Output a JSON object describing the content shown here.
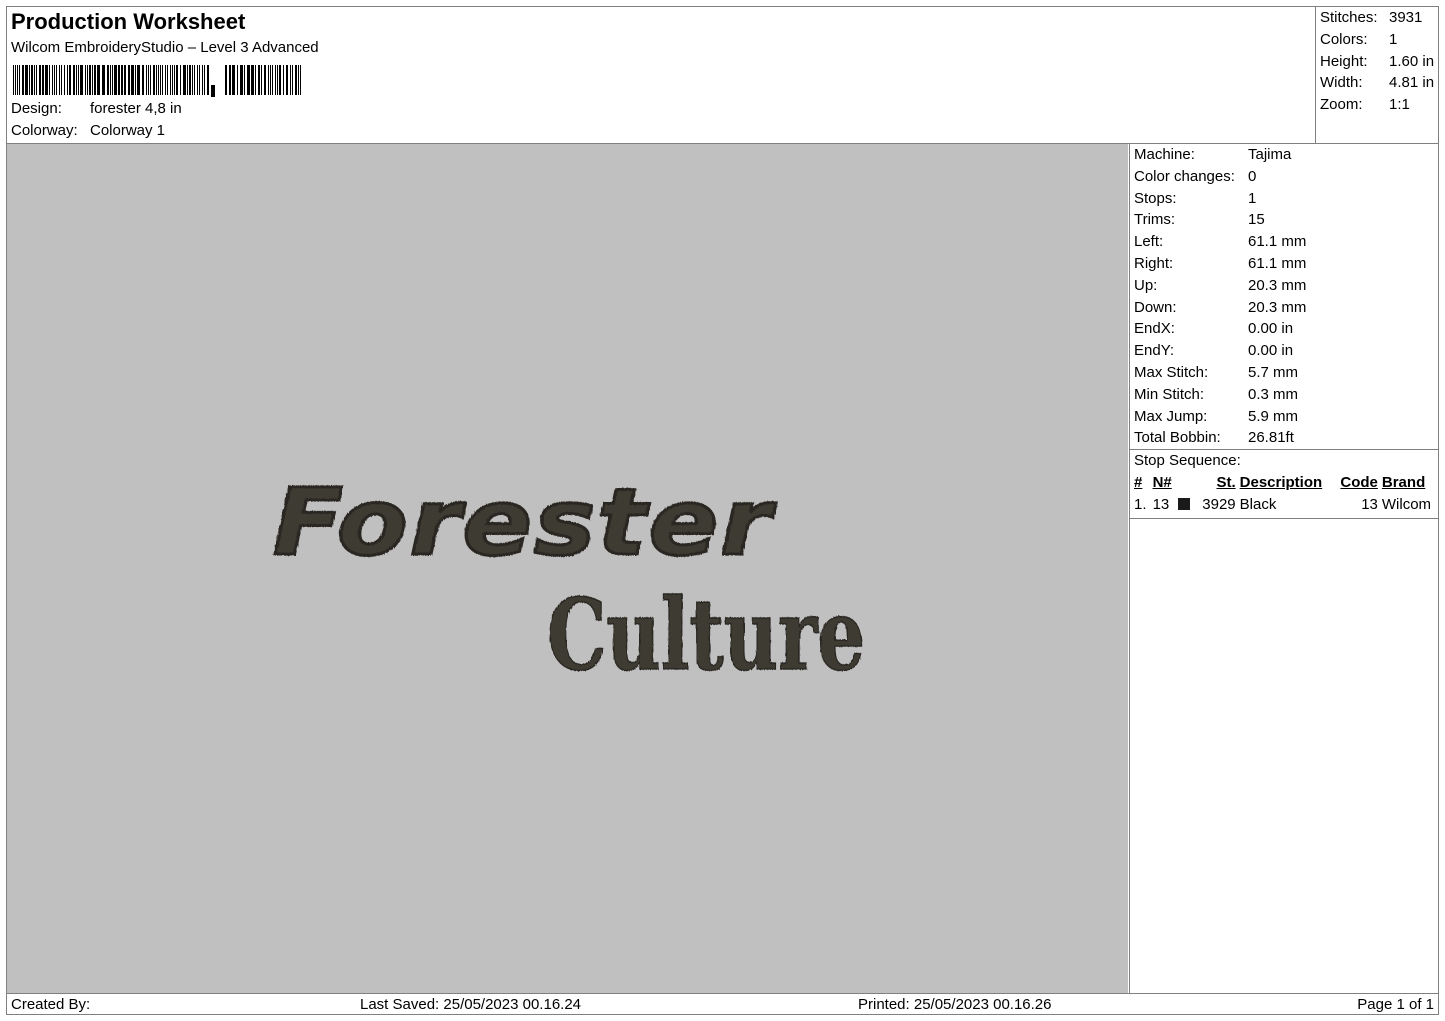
{
  "header": {
    "title": "Production Worksheet",
    "software": "Wilcom EmbroideryStudio – Level 3 Advanced",
    "design_label": "Design:",
    "design_value": "forester 4,8 in",
    "colorway_label": "Colorway:",
    "colorway_value": "Colorway 1"
  },
  "stats": [
    {
      "label": "Stitches:",
      "value": "3931"
    },
    {
      "label": "Colors:",
      "value": "1"
    },
    {
      "label": "Height:",
      "value": "1.60 in"
    },
    {
      "label": "Width:",
      "value": "4.81 in"
    },
    {
      "label": "Zoom:",
      "value": "1:1"
    }
  ],
  "machine_info": [
    {
      "label": "Machine:",
      "value": "Tajima"
    },
    {
      "label": "Color changes:",
      "value": "0"
    },
    {
      "label": "Stops:",
      "value": "1"
    },
    {
      "label": "Trims:",
      "value": "15"
    },
    {
      "label": "Left:",
      "value": "61.1 mm"
    },
    {
      "label": "Right:",
      "value": "61.1 mm"
    },
    {
      "label": "Up:",
      "value": "20.3 mm"
    },
    {
      "label": "Down:",
      "value": "20.3 mm"
    },
    {
      "label": "EndX:",
      "value": "0.00 in"
    },
    {
      "label": "EndY:",
      "value": "0.00 in"
    },
    {
      "label": "Max Stitch:",
      "value": "5.7 mm"
    },
    {
      "label": "Min Stitch:",
      "value": "0.3 mm"
    },
    {
      "label": "Max Jump:",
      "value": "5.9 mm"
    },
    {
      "label": "Total Bobbin:",
      "value": "26.81ft"
    }
  ],
  "stop_sequence": {
    "caption": "Stop Sequence:",
    "columns": [
      "#",
      "N#",
      "St.",
      "Description",
      "Code",
      "Brand"
    ],
    "rows": [
      {
        "index": "1.",
        "needle": "13",
        "swatch_color": "#1a1a1a",
        "stitches": "3929",
        "description": "Black",
        "code": "13",
        "brand": "Wilcom"
      }
    ]
  },
  "design": {
    "line1": "Forester",
    "line2": "Culture",
    "thread_color": "#3d3a33",
    "background_color": "#c0c0c0"
  },
  "footer": {
    "created_by": "Created By:",
    "last_saved": "Last Saved: 25/05/2023 00.16.24",
    "printed": "Printed: 25/05/2023 00.16.26",
    "page": "Page 1 of 1"
  }
}
